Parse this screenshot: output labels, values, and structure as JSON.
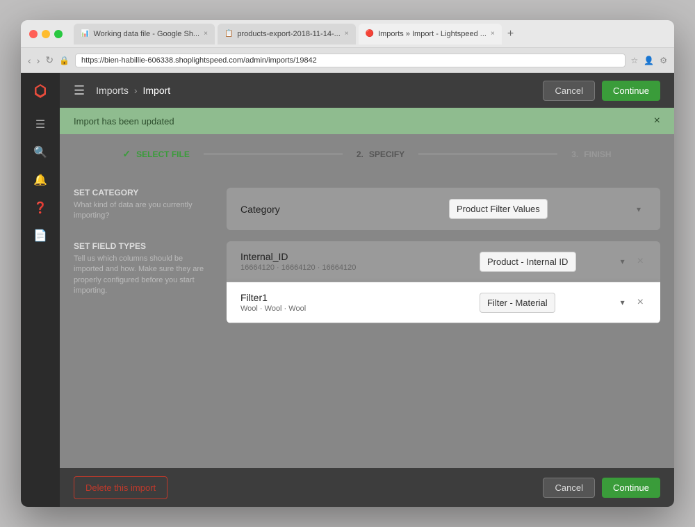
{
  "titleBar": {
    "tabs": [
      {
        "id": "tab1",
        "icon": "📊",
        "label": "Working data file - Google Sh...",
        "active": false
      },
      {
        "id": "tab2",
        "icon": "📋",
        "label": "products-export-2018-11-14-...",
        "active": false
      },
      {
        "id": "tab3",
        "icon": "🔴",
        "label": "Imports » Import - Lightspeed ...",
        "active": true
      }
    ],
    "addressBar": {
      "url": "https://bien-habillie-606338.shoplightspeed.com/admin/imports/19842"
    }
  },
  "sidebar": {
    "items": [
      {
        "id": "logo",
        "icon": "🔥",
        "label": "logo"
      },
      {
        "id": "hamburger",
        "icon": "☰",
        "label": "menu"
      },
      {
        "id": "search",
        "icon": "🔍",
        "label": "search"
      },
      {
        "id": "bell",
        "icon": "🔔",
        "label": "notifications"
      },
      {
        "id": "help",
        "icon": "❓",
        "label": "help"
      },
      {
        "id": "docs",
        "icon": "📄",
        "label": "documents"
      }
    ]
  },
  "topBar": {
    "breadcrumb": {
      "parent": "Imports",
      "separator": "›",
      "current": "Import"
    },
    "cancelLabel": "Cancel",
    "continueLabel": "Continue"
  },
  "notification": {
    "message": "Import has been updated",
    "closeIcon": "×"
  },
  "stepper": {
    "steps": [
      {
        "id": "step1",
        "number": "1",
        "label": "SELECT FILE",
        "state": "completed"
      },
      {
        "id": "step2",
        "number": "2",
        "label": "SPECIFY",
        "state": "current"
      },
      {
        "id": "step3",
        "number": "3",
        "label": "FINISH",
        "state": "future"
      }
    ]
  },
  "setCategorySection": {
    "title": "SET CATEGORY",
    "description": "What kind of data are you currently importing?",
    "categoryLabel": "Category",
    "categoryValue": "Product Filter Values"
  },
  "setFieldTypesSection": {
    "title": "SET FIELD TYPES",
    "description": "Tell us which columns should be imported and how. Make sure they are properly configured before you start importing.",
    "fields": [
      {
        "id": "field1",
        "name": "Internal_ID",
        "values": "16664120 · 16664120 · 16664120",
        "selectedOption": "Product - Internal ID",
        "highlighted": false
      },
      {
        "id": "field2",
        "name": "Filter1",
        "values": "Wool · Wool · Wool",
        "selectedOption": "Filter - Material",
        "highlighted": true
      }
    ]
  },
  "bottomBar": {
    "deleteLabel": "Delete this import",
    "cancelLabel": "Cancel",
    "continueLabel": "Continue"
  },
  "colors": {
    "green": "#3a9c3a",
    "red": "#c0392b",
    "sidebar": "#2b2b2b",
    "topBar": "#3d3d3d",
    "notification": "#8fbc8f"
  }
}
